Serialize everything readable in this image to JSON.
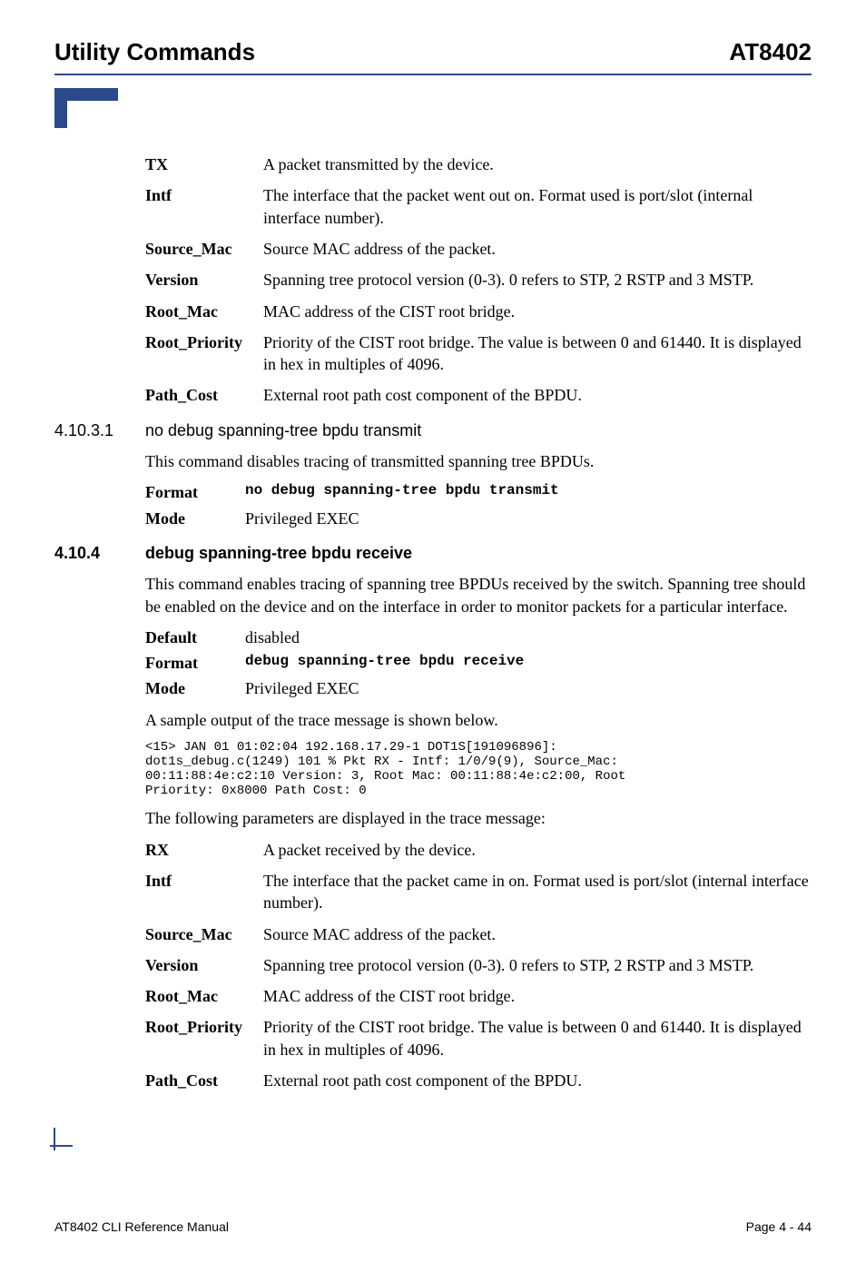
{
  "header": {
    "left": "Utility Commands",
    "right": "AT8402"
  },
  "params_tx": [
    {
      "term": "TX",
      "desc": "A packet transmitted by the device."
    },
    {
      "term": "Intf",
      "desc": "The interface that the packet went out on. Format used is port/slot (internal interface number)."
    },
    {
      "term": "Source_Mac",
      "desc": "Source MAC address of the packet."
    },
    {
      "term": "Version",
      "desc": "Spanning tree protocol version (0-3). 0 refers to STP, 2 RSTP and 3 MSTP."
    },
    {
      "term": "Root_Mac",
      "desc": "MAC address of the CIST root bridge."
    },
    {
      "term": "Root_Priority",
      "desc": "Priority of the CIST root bridge. The value is between 0 and 61440. It is displayed in hex in multiples of 4096."
    },
    {
      "term": "Path_Cost",
      "desc": "External root path cost component of the BPDU."
    }
  ],
  "sec_41031": {
    "num": "4.10.3.1",
    "title": "no debug spanning-tree bpdu transmit",
    "intro": "This command disables tracing of transmitted spanning tree BPDUs.",
    "format_label": "Format",
    "format_value": "no debug spanning-tree bpdu transmit",
    "mode_label": "Mode",
    "mode_value": "Privileged EXEC"
  },
  "sec_4104": {
    "num": "4.10.4",
    "title": "debug spanning-tree bpdu receive",
    "intro": "This command enables tracing of spanning tree BPDUs received by the switch. Spanning tree should be enabled on the device and on the interface in order to monitor packets for a particular interface.",
    "default_label": "Default",
    "default_value": "disabled",
    "format_label": "Format",
    "format_value": "debug spanning-tree bpdu receive",
    "mode_label": "Mode",
    "mode_value": "Privileged EXEC",
    "sample_intro": "A sample output of the trace message is shown below.",
    "sample_output": "<15> JAN 01 01:02:04 192.168.17.29-1 DOT1S[191096896]:\ndot1s_debug.c(1249) 101 % Pkt RX - Intf: 1/0/9(9), Source_Mac:\n00:11:88:4e:c2:10 Version: 3, Root Mac: 00:11:88:4e:c2:00, Root\nPriority: 0x8000 Path Cost: 0",
    "params_intro": "The following parameters are displayed in the trace message:"
  },
  "params_rx": [
    {
      "term": "RX",
      "desc": "A packet received by the device."
    },
    {
      "term": "Intf",
      "desc": "The interface that the packet came in on. Format used is port/slot (internal interface number)."
    },
    {
      "term": "Source_Mac",
      "desc": "Source MAC address of the packet."
    },
    {
      "term": "Version",
      "desc": "Spanning tree protocol version (0-3). 0 refers to STP, 2 RSTP and 3 MSTP."
    },
    {
      "term": "Root_Mac",
      "desc": "MAC address of the CIST root bridge."
    },
    {
      "term": "Root_Priority",
      "desc": "Priority of the CIST root bridge. The value is between 0 and 61440. It is displayed in hex in multiples of 4096."
    },
    {
      "term": "Path_Cost",
      "desc": "External root path cost component of the BPDU."
    }
  ],
  "footer": {
    "left": "AT8402 CLI Reference Manual",
    "right": "Page 4 - 44"
  }
}
